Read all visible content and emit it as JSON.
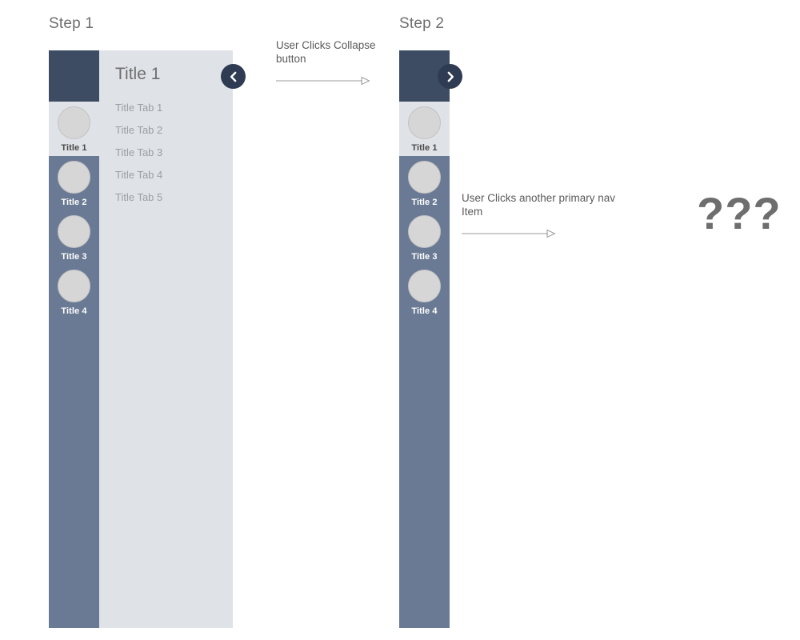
{
  "steps": [
    {
      "label": "Step 1",
      "state": "expanded",
      "primary_nav": {
        "items": [
          {
            "label": "Title 1",
            "active": true
          },
          {
            "label": "Title 2",
            "active": false
          },
          {
            "label": "Title 3",
            "active": false
          },
          {
            "label": "Title 4",
            "active": false
          }
        ]
      },
      "secondary_panel": {
        "title": "Title 1",
        "tabs": [
          "Title Tab 1",
          "Title Tab 2",
          "Title Tab 3",
          "Title Tab 4",
          "Title Tab 5"
        ]
      },
      "toggle_button": {
        "icon": "chevron-left-icon",
        "action": "collapse"
      }
    },
    {
      "label": "Step 2",
      "state": "collapsed",
      "primary_nav": {
        "items": [
          {
            "label": "Title 1",
            "active": true
          },
          {
            "label": "Title 2",
            "active": false
          },
          {
            "label": "Title 3",
            "active": false
          },
          {
            "label": "Title 4",
            "active": false
          }
        ]
      },
      "toggle_button": {
        "icon": "chevron-right-icon",
        "action": "expand"
      }
    }
  ],
  "annotations": [
    {
      "text": "User Clicks Collapse button",
      "arrow": "arrow-right"
    },
    {
      "text": "User Clicks another primary nav Item",
      "arrow": "arrow-right"
    }
  ],
  "unknown_state": {
    "text": "???"
  },
  "colors": {
    "nav_header": "#3e4c63",
    "nav_background": "#6a7a94",
    "panel_background": "#dfe2e7",
    "avatar": "#d6d6d6",
    "button": "#2e3b52",
    "text_muted": "#6e6e6e",
    "tab_text": "#9aa0a6"
  }
}
